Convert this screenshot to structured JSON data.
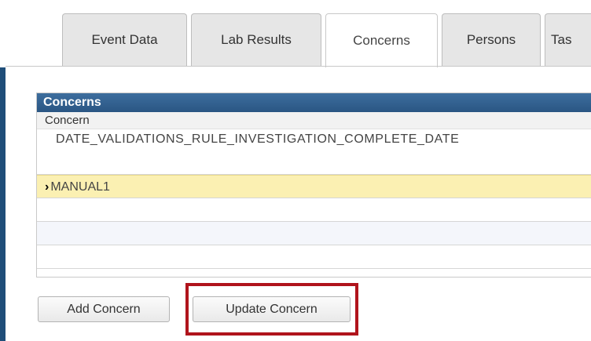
{
  "tabs": [
    {
      "label": "Event Data",
      "active": false
    },
    {
      "label": "Lab Results",
      "active": false
    },
    {
      "label": "Concerns",
      "active": true
    },
    {
      "label": "Persons",
      "active": false
    },
    {
      "label": "Tas",
      "active": false
    }
  ],
  "concerns_panel": {
    "title": "Concerns",
    "column_header": "Concern",
    "rows": [
      {
        "text": "DATE_VALIDATIONS_RULE_INVESTIGATION_COMPLETE_DATE",
        "selected": false
      },
      {
        "text": "MANUAL1",
        "selected": true,
        "marker": "›"
      },
      {
        "text": ""
      },
      {
        "text": ""
      },
      {
        "text": ""
      }
    ]
  },
  "buttons": {
    "add_concern": "Add Concern",
    "update_concern": "Update Concern"
  },
  "colors": {
    "panel_header": "#2f5f8f",
    "selected_row": "#fbf0b2",
    "highlight_box": "#b0141c",
    "left_frame": "#1f4e79"
  }
}
